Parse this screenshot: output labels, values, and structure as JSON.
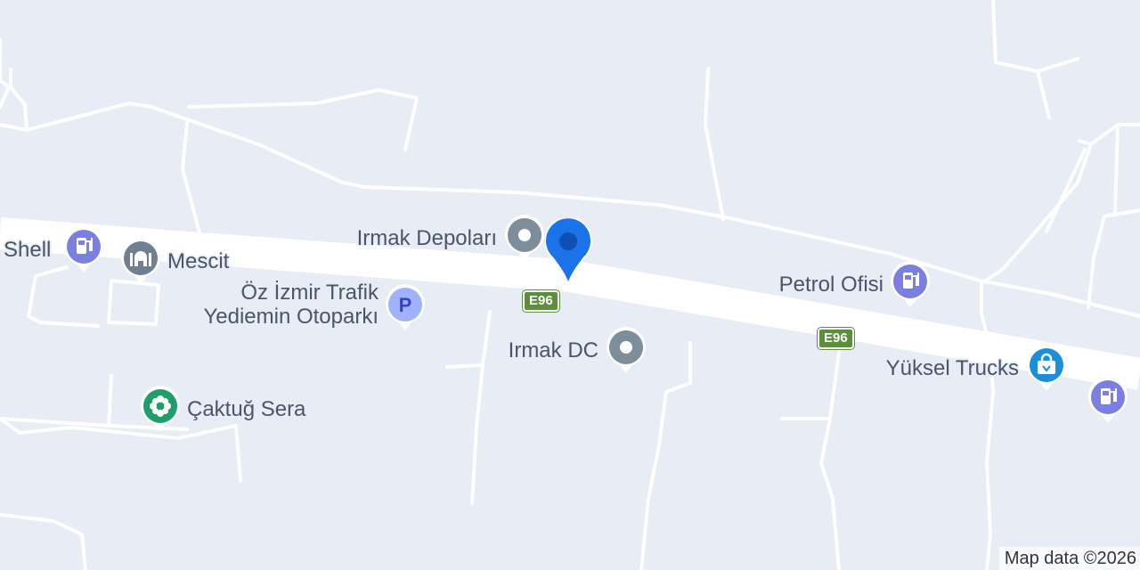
{
  "map": {
    "colors": {
      "land": "#e8ecf5",
      "road": "#ffffff",
      "road_outline": "#ffffff",
      "label_text": "#4a5568",
      "shield_green": "#5c8f3a",
      "gas_pin": "#7b7fe0",
      "worship_pin": "#708090",
      "parking_pin": "#8a9bf5",
      "generic_pin": "#7d8d99",
      "garden_pin": "#1e9e6a",
      "shopping_pin": "#1a8fd8",
      "marker_blue": "#1a73e8"
    },
    "highway_shields": [
      {
        "id": "e96-1",
        "text": "E96"
      },
      {
        "id": "e96-2",
        "text": "E96"
      }
    ],
    "places": [
      {
        "id": "shell",
        "name": "Shell",
        "icon": "gas-station-icon"
      },
      {
        "id": "mescit",
        "name": "Mescit",
        "icon": "mosque-icon"
      },
      {
        "id": "oz-izmir",
        "name": "Öz İzmir Trafik",
        "name2": "Yediemin Otoparkı",
        "icon": "parking-icon"
      },
      {
        "id": "irmak-depolari",
        "name": "Irmak Depoları",
        "icon": "place-dot-icon"
      },
      {
        "id": "irmak-dc",
        "name": "Irmak DC",
        "icon": "place-dot-icon"
      },
      {
        "id": "caktug-sera",
        "name": "Çaktuğ Sera",
        "icon": "flower-icon"
      },
      {
        "id": "petrol-ofisi",
        "name": "Petrol Ofisi",
        "icon": "gas-station-icon"
      },
      {
        "id": "yuksel-trucks",
        "name": "Yüksel Trucks",
        "icon": "shopping-bag-icon"
      },
      {
        "id": "unnamed-gas",
        "name": "",
        "icon": "gas-station-icon"
      }
    ],
    "selected_marker": {
      "icon": "location-marker-icon"
    },
    "attribution": "Map data ©2026"
  }
}
